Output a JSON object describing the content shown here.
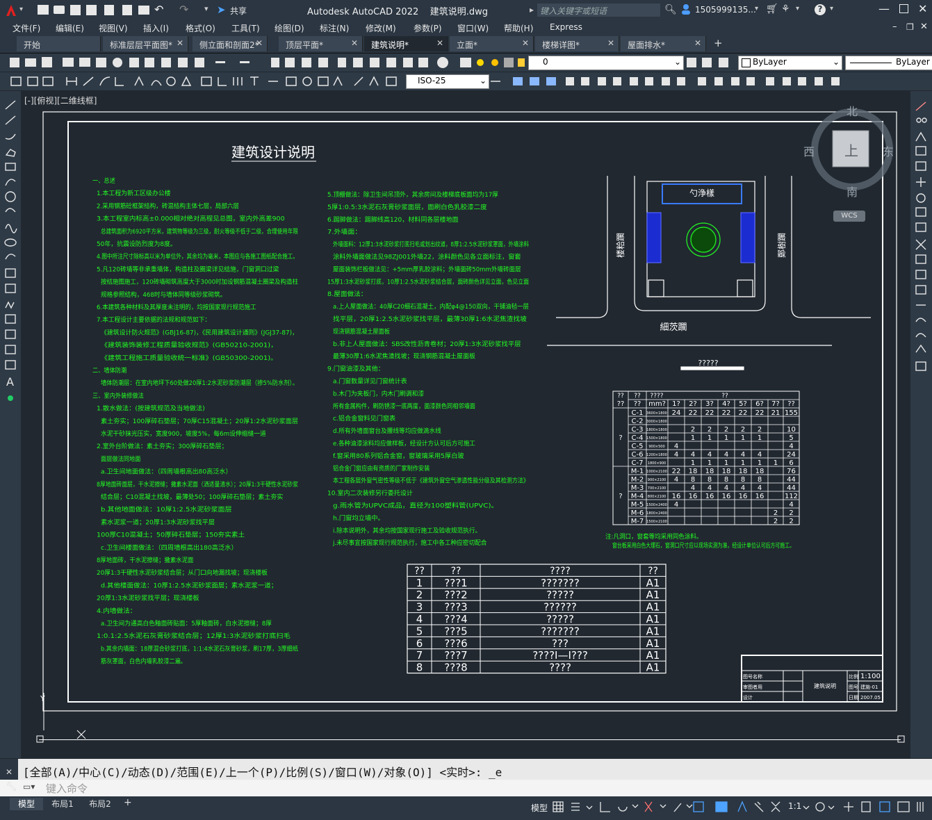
{
  "app": {
    "title": "Autodesk AutoCAD 2022    建筑说明.dwg",
    "search_placeholder": "键入关键字或短语",
    "user": "1505999135...",
    "share_label": "共享"
  },
  "menu": [
    "文件(F)",
    "编辑(E)",
    "视图(V)",
    "插入(I)",
    "格式(O)",
    "工具(T)",
    "绘图(D)",
    "标注(N)",
    "修改(M)",
    "参数(P)",
    "窗口(W)",
    "帮助(H)",
    "Express"
  ],
  "tabs": [
    {
      "label": "开始",
      "close": false
    },
    {
      "label": "标准层层平面图*",
      "close": true
    },
    {
      "label": "侧立面和剖面2*",
      "close": true
    },
    {
      "label": "顶层平面*",
      "close": true
    },
    {
      "label": "建筑说明*",
      "close": true,
      "active": true
    },
    {
      "label": "立面*",
      "close": true
    },
    {
      "label": "楼梯详图*",
      "close": true
    },
    {
      "label": "屋面排水*",
      "close": true
    }
  ],
  "toolbar": {
    "layer_value": "0",
    "color_value": "ByLayer",
    "linetype_value": "ByLayer",
    "dimstyle_value": "ISO-25"
  },
  "viewport_label": "[-][俯视][二维线框]",
  "viewcube": {
    "north": "北",
    "south": "南",
    "east": "东",
    "west": "西",
    "top": "上",
    "wcs": "WCS"
  },
  "drawing": {
    "title": "建筑设计说明",
    "site_labels": {
      "entrance": "勺浄樣",
      "street_bottom": "細茨躙",
      "street_left": "楼粭躙",
      "street_right": "鄭樹躙",
      "site_tag": "?????"
    },
    "notes_left": [
      "一、总述",
      "1.本工程为新工区级办公楼",
      "2.采用钢筋砼框架结构，砖混结构主体七层，局部六层",
      "3.本工程室内标高±0.000相对绝对高程见总图，室内外高差900",
      "总建筑面积为6920平方米，建筑物等级为三级，耐火等级不低于二级，合理使用年限",
      "50年，抗震设防烈度为8度。",
      "4.图中所注尺寸除标高以米为单位外，其余均为毫米，本图应与各施工图纸配合施工。",
      "5.凡120砖墙等非承重墙体，构造柱及圈梁详见结施，门窗洞口过梁",
      "按结施图施工，120砖墙砌筑高度大于3000时加设钢筋混凝土圈梁及构造柱",
      "规格参照结构，468时与墙体同等级砂浆砌筑。",
      "6.本建筑各种材料及其厚度未注明的，均按国家现行规范施工",
      "7.本工程设计主要依据的法规和规范如下：",
      "《建筑设计防火规范》(GBJ16-87)，《民用建筑设计通则》(JGJ37-87)，",
      "《建筑装饰装修工程质量验收规范》(GB50210-2001)，",
      "《建筑工程施工质量验收统一标准》(GB50300-2001)。",
      "二、墙体防潮",
      "墙体防潮层：在室内地坪下60处做20厚1:2水泥砂浆防潮层（掺5%防水剂）。",
      "三、室内外装修做法",
      "1.散水做法：(按建筑规范及当地做法)",
      "素土夯实；100厚碎石垫层；70厚C15混凝土；20厚1:2水泥砂浆面层",
      "水泥干砂抹光压实，宽度900，坡度5%，每6m设伸缩缝一道",
      "2.室外台阶做法：素土夯实；300厚碎石垫层；",
      "面层做法同地面",
      "a.卫生间地面做法：（四周墙根高出80高泛水）",
      "8厚地面砖面层，干水泥擦缝；撒素水泥面（洒适量清水）；20厚1:3干硬性水泥砂浆",
      "结合层；C10混凝土找坡，最薄处50；100厚碎石垫层；素土夯实",
      "b.其他地面做法：10厚1:2.5水泥砂浆面层",
      "素水泥浆一道；20厚1:3水泥砂浆找平层",
      "100厚C10混凝土；50厚碎石垫层；150夯实素土",
      "c.卫生间楼面做法：（四周墙根高出180高泛水）",
      "8厚地面砖，干水泥擦缝；撒素水泥面",
      "20厚1:3干硬性水泥砂浆结合层；从门口向地漏找坡；现浇楼板",
      "d.其他楼面做法：10厚1:2.5水泥砂浆面层；素水泥浆一道；",
      "20厚1:3水泥砂浆找平层；现浇楼板",
      "4.内墙做法：",
      "a.卫生间为通高白色釉面砖贴面：5厚釉面砖，白水泥擦缝；8厚",
      "1:0.1:2.5水泥石灰膏砂浆结合层；12厚1:3水泥砂浆打底扫毛",
      "b.其余内墙面：18厚混合砂浆打底，1:1:4水泥石灰膏砂浆，刷17厚，3厚细纸",
      "筋灰罩面，白色内墙乳胶漆二遍。"
    ],
    "notes_right": [
      "5.顶棚做法：除卫生间吊顶外，其余房间及楼梯底板面均为17厚",
      "5厚1:0.5:3水泥石灰膏砂浆面层，面刷白色乳胶漆二度",
      "6.踢脚做法：踢脚线高120，材料同各层楼地面",
      "7.外墙面：",
      "外墙面料：12厚1:3水泥砂浆打底扫毛或划出纹道，8厚1:2.5水泥砂浆罩面，外墙涂料",
      "涂料外墙面做法见98ZJ001外墙22，涂料颜色见各立面标注，窗套",
      "屋面装饰栏板做法见：+5mm厚乳胶涂料；外墙面砖50mm外墙砖面层",
      "15厚1:3水泥砂浆打底，10厚1:2.5水泥砂浆结合层，面砖颜色详见立面，色见立面",
      "8.屋面做法：",
      "a.上人屋面做法：40厚C20细石混凝土，内配φ4@150双向，干铺油毡一层",
      "找平层，20厚1:2.5水泥砂浆找平层，最薄30厚1:6水泥焦渣找坡",
      "现浇钢筋混凝土屋面板",
      "b.非上人屋面做法：SBS改性沥青卷材；20厚1:3水泥砂浆找平层",
      "最薄30厚1:6水泥焦渣找坡；现浇钢筋混凝土屋面板",
      "9.门窗油漆及其他：",
      "a.门窗数量详见门窗统计表",
      "b.木门为夹板门，内木门刷调和漆",
      "所有金属构件，刷防锈漆一底两度，面漆颜色同相邻墙面",
      "c.铝合金窗料见门窗表",
      "d.所有外墙面窗台及腰线等均应做滴水线",
      "e.各种油漆涂料均应做样板，经设计方认可后方可施工",
      "f.窗采用80系列铝合金窗，窗玻璃采用5厚白玻",
      "铝合金门窗应由有资质的厂家制作安装",
      "本工程各层外窗气密性等级不低于《建筑外窗空气渗透性能分级及其检测方法》",
      "10.室内二次装修另行委托设计",
      "g.雨水管为UPVC成品，直径为100塑料管(UPVC)。",
      "h.门窗均立墙中。",
      "i.除本说明外，其余均按国家现行施工及验收规范执行。",
      "j.未尽事宜按国家现行规范执行，施工中各工种应密切配合"
    ],
    "door_note": [
      "注:凡洞口，窗套等均采用同色涂料。",
      "窗台板采用白色大理石，窗洞口尺寸应以现场实测为准，经设计单位认可后方可施工。"
    ],
    "door_table": {
      "header1": [
        "??",
        "??",
        "????",
        "??"
      ],
      "header2": [
        "??",
        "??",
        "mm?",
        "1?",
        "2?",
        "3?",
        "4?",
        "5?",
        "6?",
        "7?",
        "??"
      ],
      "groups": [
        {
          "type": "?",
          "rows": [
            {
              "code": "C-1",
              "size": "3600×1800",
              "q": [
                "24",
                "22",
                "22",
                "22",
                "22",
                "22",
                "21",
                "155"
              ]
            },
            {
              "code": "C-2",
              "size": "3000×1800",
              "q": [
                "",
                "",
                "",
                "",
                "",
                "",
                "",
                ""
              ]
            },
            {
              "code": "C-3",
              "size": "1800×1800",
              "q": [
                "",
                "2",
                "2",
                "2",
                "2",
                "2",
                "",
                "10"
              ]
            },
            {
              "code": "C-4",
              "size": "1500×1800",
              "q": [
                "",
                "1",
                "1",
                "1",
                "1",
                "1",
                "",
                "5"
              ]
            },
            {
              "code": "C-5",
              "size": "900×500",
              "q": [
                "4",
                "",
                "",
                "",
                "",
                "",
                "",
                "4"
              ]
            },
            {
              "code": "C-6",
              "size": "1200×1800",
              "q": [
                "4",
                "4",
                "4",
                "4",
                "4",
                "4",
                "",
                "24"
              ]
            },
            {
              "code": "C-7",
              "size": "1800×900",
              "q": [
                "",
                "1",
                "1",
                "1",
                "1",
                "1",
                "1",
                "6"
              ]
            }
          ]
        },
        {
          "type": "?",
          "rows": [
            {
              "code": "M-1",
              "size": "1000×2100",
              "q": [
                "22",
                "18",
                "18",
                "18",
                "18",
                "18",
                "",
                "76"
              ]
            },
            {
              "code": "M-2",
              "size": "900×2100",
              "q": [
                "4",
                "8",
                "8",
                "8",
                "8",
                "8",
                "",
                "44"
              ]
            },
            {
              "code": "M-3",
              "size": "700×2100",
              "q": [
                "",
                "4",
                "4",
                "4",
                "4",
                "4",
                "",
                "44"
              ]
            },
            {
              "code": "M-4",
              "size": "800×2100",
              "q": [
                "16",
                "16",
                "16",
                "16",
                "16",
                "16",
                "",
                "112"
              ]
            },
            {
              "code": "M-5",
              "size": "1500×2400",
              "q": [
                "4",
                "",
                "",
                "",
                "",
                "",
                "",
                "4"
              ]
            },
            {
              "code": "M-6",
              "size": "1800×2400",
              "q": [
                "",
                "",
                "",
                "",
                "",
                "",
                "2",
                "2"
              ]
            },
            {
              "code": "M-7",
              "size": "1500×2100",
              "q": [
                "",
                "",
                "",
                "",
                "",
                "",
                "2",
                "2"
              ]
            }
          ]
        }
      ]
    },
    "index_table": {
      "header": [
        "??",
        "??",
        "????",
        "??"
      ],
      "rows": [
        [
          "1",
          "???1",
          "???????",
          "A1"
        ],
        [
          "2",
          "???2",
          "?????",
          "A1"
        ],
        [
          "3",
          "???3",
          "??????",
          "A1"
        ],
        [
          "4",
          "???4",
          "?????",
          "A1"
        ],
        [
          "5",
          "???5",
          "???????",
          "A1"
        ],
        [
          "6",
          "???6",
          "???",
          "A1"
        ],
        [
          "7",
          "???7",
          "????I—I???",
          "A1"
        ],
        [
          "8",
          "???8",
          "????",
          "A1"
        ]
      ]
    },
    "titleblock": {
      "name": "建筑说明",
      "rows_left": [
        "图号名称",
        "审图者用",
        "设计"
      ],
      "scale_label": "比例",
      "scale_value": "1:100",
      "no_label": "图号",
      "no_value": "建施-01",
      "date_label": "日期",
      "date_value": "2007.05"
    }
  },
  "command": {
    "history": "[全部(A)/中心(C)/动态(D)/范围(E)/上一个(P)/比例(S)/窗口(W)/对象(O)] <实时>: _e",
    "placeholder": "键入命令"
  },
  "layout_tabs": [
    "模型",
    "布局1",
    "布局2"
  ],
  "status": {
    "model": "模型",
    "scale": "1:1"
  }
}
